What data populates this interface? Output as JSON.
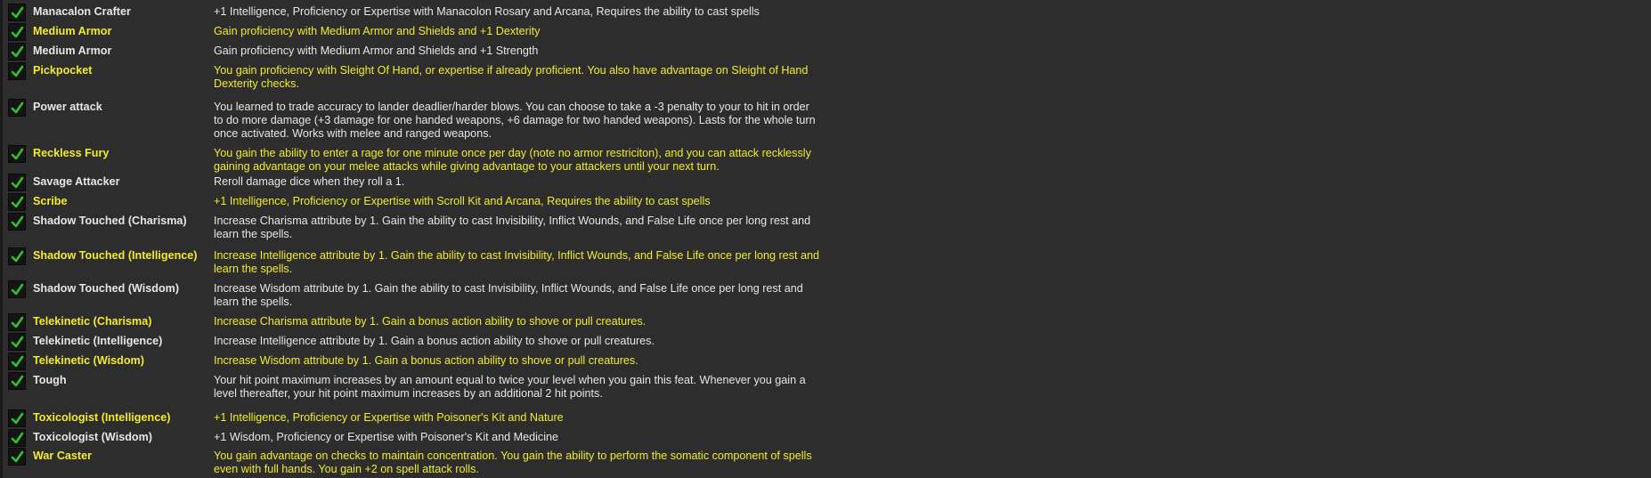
{
  "colors": {
    "background": "#2d2d2d",
    "selected_text": "#f2ec2a",
    "normal_text": "#e6e6e6",
    "check_green": "#2fc32f"
  },
  "feats": [
    {
      "name": "Manacalon Crafter",
      "desc": "+1 Intelligence, Proficiency or Expertise with Manacolon Rosary and Arcana, Requires the ability to cast spells",
      "checked": true
    },
    {
      "name": "Medium Armor",
      "desc": "Gain proficiency with Medium Armor and Shields and +1 Dexterity",
      "checked": true
    },
    {
      "name": "Medium Armor",
      "desc": "Gain proficiency with Medium Armor and Shields and +1 Strength",
      "checked": true
    },
    {
      "name": "Pickpocket",
      "desc": "You gain proficiency with Sleight Of Hand, or expertise if already proficient. You also have advantage on Sleight of Hand Dexterity checks.",
      "checked": true
    },
    {
      "name": "Power attack",
      "desc": "You learned to trade accuracy to lander deadlier/harder blows.  You can choose to take a -3 penalty to your to hit in order to do more damage (+3 damage for one handed weapons, +6 damage for two handed weapons).  Lasts for the whole turn once activated.  Works with melee and ranged weapons.",
      "checked": true
    },
    {
      "name": "Reckless Fury",
      "desc": "You gain the ability to enter a rage for one minute once per day (note no armor restriciton), and you can attack recklessly gaining advantage on your melee attacks while giving advantage to your attackers until your next turn.",
      "checked": true
    },
    {
      "name": "Savage Attacker",
      "desc": "Reroll damage dice when they roll a 1.",
      "checked": true
    },
    {
      "name": "Scribe",
      "desc": "+1 Intelligence, Proficiency or Expertise with Scroll Kit and Arcana, Requires the ability to cast spells",
      "checked": true
    },
    {
      "name": "Shadow Touched (Charisma)",
      "desc": "Increase Charisma attribute by 1. Gain the ability to cast Invisibility, Inflict Wounds, and False Life once per long rest and learn the spells.",
      "checked": true
    },
    {
      "name": "Shadow Touched (Intelligence)",
      "desc": "Increase Intelligence attribute by 1. Gain the ability to cast Invisibility, Inflict Wounds, and False Life once per long rest and learn the spells.",
      "checked": true
    },
    {
      "name": "Shadow Touched (Wisdom)",
      "desc": "Increase Wisdom attribute by 1. Gain the ability to cast Invisibility, Inflict Wounds, and False Life once per long rest and learn the spells.",
      "checked": true
    },
    {
      "name": "Telekinetic (Charisma)",
      "desc": "Increase Charisma attribute by 1. Gain a bonus action ability to shove or pull creatures.",
      "checked": true
    },
    {
      "name": "Telekinetic (Intelligence)",
      "desc": "Increase Intelligence attribute by 1. Gain a bonus action ability to shove or pull creatures.",
      "checked": true
    },
    {
      "name": "Telekinetic (Wisdom)",
      "desc": "Increase Wisdom attribute by 1. Gain a bonus action ability to shove or pull creatures.",
      "checked": true
    },
    {
      "name": "Tough",
      "desc": "Your hit point maximum increases by an amount equal to twice your level when you gain this feat. Whenever you gain a level thereafter, your hit point maximum increases by an additional 2 hit points.",
      "checked": true
    },
    {
      "name": "Toxicologist (Intelligence)",
      "desc": "+1 Intelligence, Proficiency or Expertise with Poisoner's Kit and Nature",
      "checked": true
    },
    {
      "name": "Toxicologist (Wisdom)",
      "desc": "+1 Wisdom, Proficiency or Expertise with Poisoner's Kit and Medicine",
      "checked": true
    },
    {
      "name": "War Caster",
      "desc": "You gain advantage on checks to maintain concentration. You gain the ability to perform the somatic component of spells even with full hands. You gain +2 on spell attack rolls.",
      "checked": true
    }
  ]
}
